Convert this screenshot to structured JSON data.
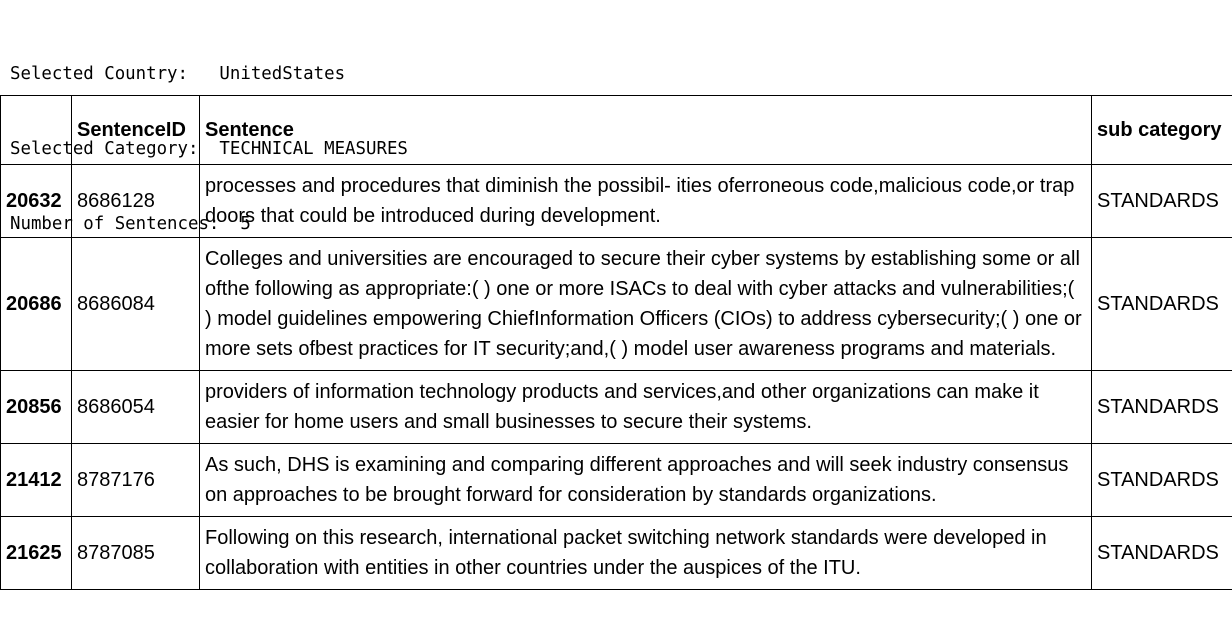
{
  "summary": [
    {
      "label": "Selected Country:",
      "value": "UnitedStates",
      "pad": "   "
    },
    {
      "label": "Selected Category:",
      "value": "TECHNICAL MEASURES",
      "pad": "  "
    },
    {
      "label": "Number of Sentences:",
      "value": "5",
      "pad": "  "
    }
  ],
  "table": {
    "columns": [
      "",
      "SentenceID",
      "Sentence",
      "sub category"
    ],
    "rows": [
      {
        "index": "20632",
        "sentence_id": "8686128",
        "sentence": "processes and procedures that diminish the possibil- ities oferroneous code,malicious code,or trap doors that could be introduced during development.",
        "sub_category": "STANDARDS"
      },
      {
        "index": "20686",
        "sentence_id": "8686084",
        "sentence": "Colleges and universities are encouraged to secure their cyber systems by establishing some or all ofthe following as appropriate:( ) one or more ISACs to deal with cyber attacks and vulnerabilities;( ) model guidelines empowering ChiefInformation Officers (CIOs) to address cybersecurity;( ) one or more sets ofbest practices for IT security;and,( ) model user awareness programs and materials.",
        "sub_category": "STANDARDS"
      },
      {
        "index": "20856",
        "sentence_id": "8686054",
        "sentence": "providers of information technology products and services,and other organizations can make it easier for home users and small businesses to secure their systems.",
        "sub_category": "STANDARDS"
      },
      {
        "index": "21412",
        "sentence_id": "8787176",
        "sentence": "As such, DHS is examining and comparing different approaches and will seek industry consensus on approaches to be brought forward for consideration by standards organizations.",
        "sub_category": "STANDARDS"
      },
      {
        "index": "21625",
        "sentence_id": "8787085",
        "sentence": "Following on this research, international packet switching network standards were developed in collaboration with entities in other countries under the auspices of the ITU.",
        "sub_category": "STANDARDS"
      }
    ]
  }
}
